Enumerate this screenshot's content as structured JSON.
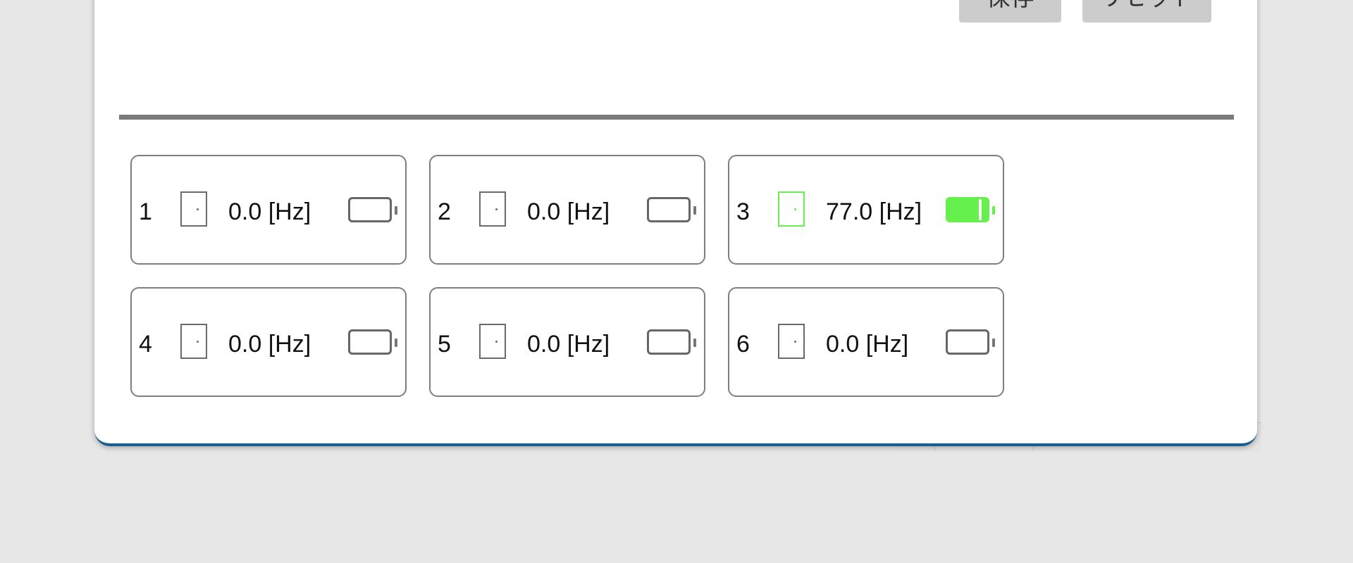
{
  "buttons": {
    "save_label": "保存",
    "reset_label": "リセット"
  },
  "sensors": [
    {
      "id": "1",
      "frequency": "0.0 [Hz]",
      "active": false
    },
    {
      "id": "2",
      "frequency": "0.0 [Hz]",
      "active": false
    },
    {
      "id": "3",
      "frequency": "77.0 [Hz]",
      "active": true
    },
    {
      "id": "4",
      "frequency": "0.0 [Hz]",
      "active": false
    },
    {
      "id": "5",
      "frequency": "0.0 [Hz]",
      "active": false
    },
    {
      "id": "6",
      "frequency": "0.0 [Hz]",
      "active": false
    }
  ],
  "colors": {
    "active": "#66f04d",
    "inactive": "#6a6a6a",
    "button_bg": "#cccccc",
    "divider": "#7a7a7a"
  },
  "icons": {
    "door": "door-icon",
    "battery": "battery-icon"
  }
}
